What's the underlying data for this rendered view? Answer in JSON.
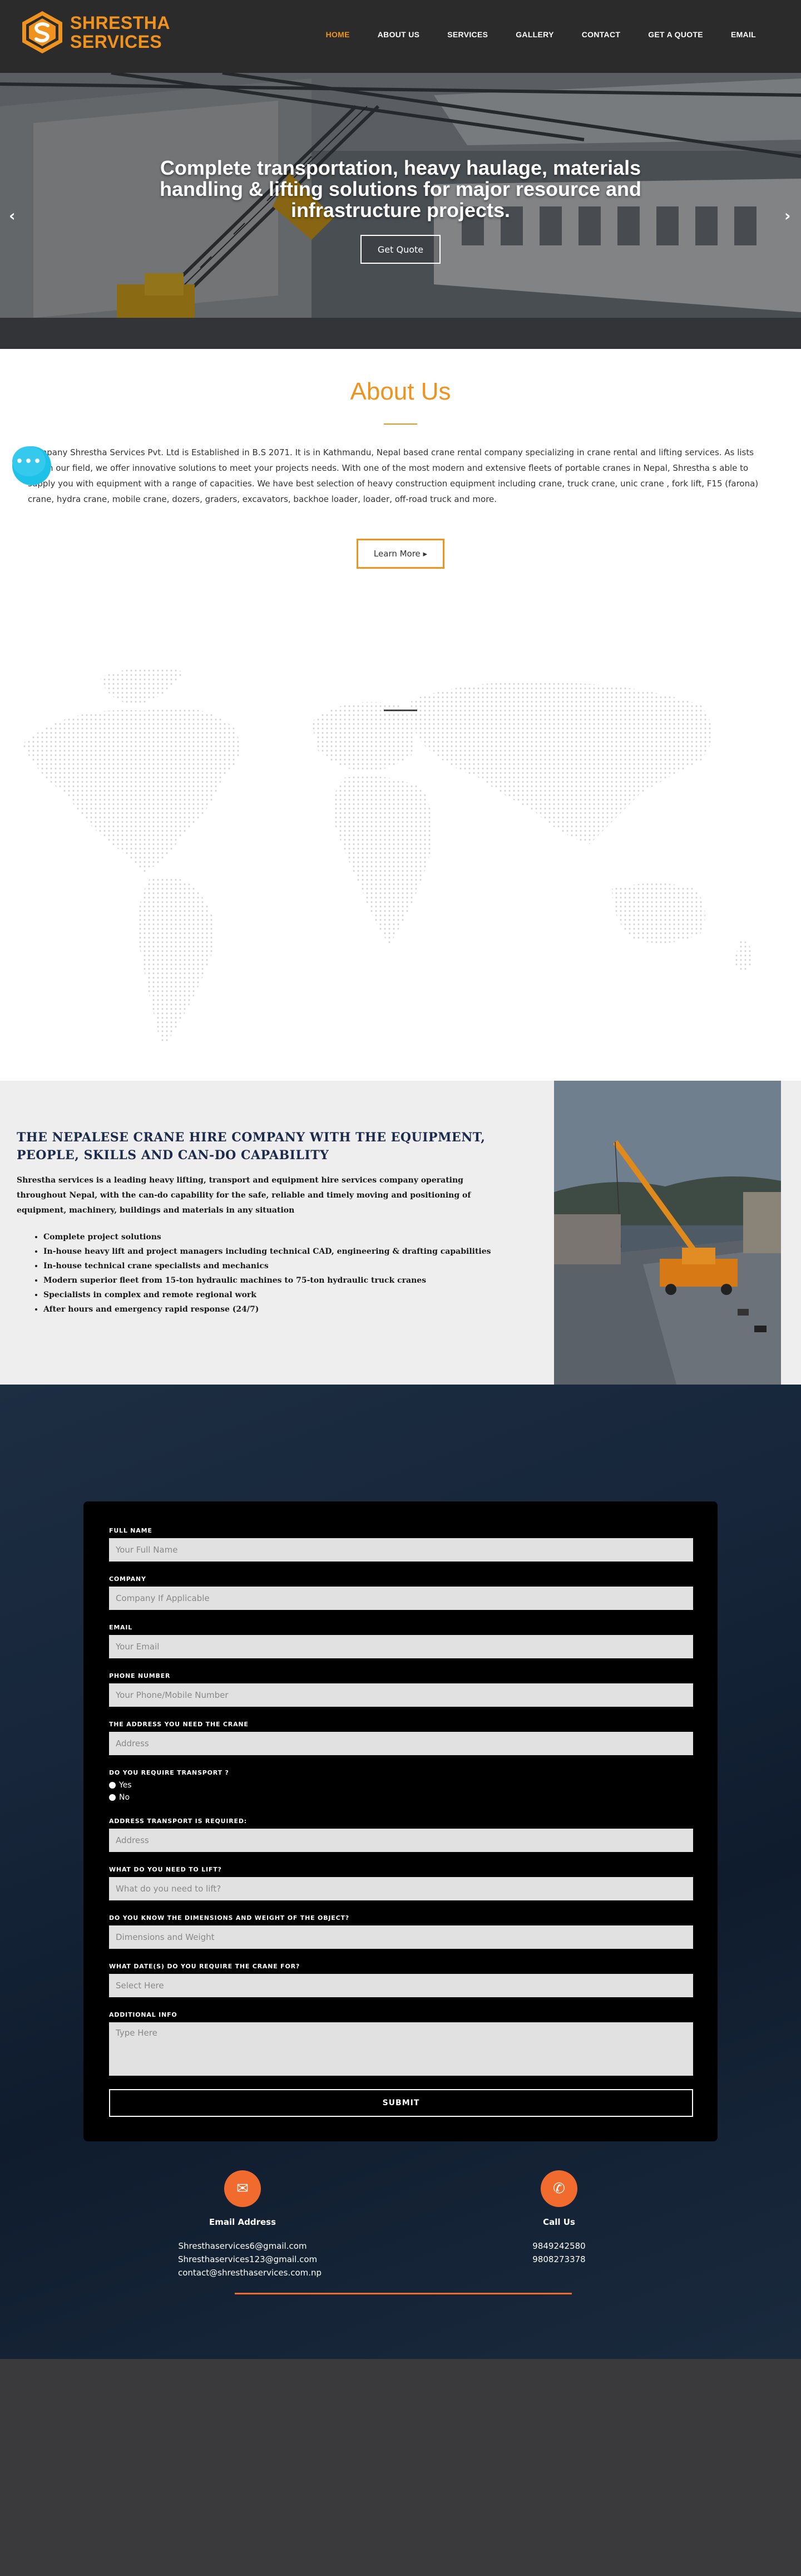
{
  "brand": {
    "line1": "SHRESTHA",
    "line2": "SERVICES",
    "accent": "#f0931e"
  },
  "nav": [
    {
      "label": "HOME",
      "active": true
    },
    {
      "label": "ABOUT US"
    },
    {
      "label": "SERVICES"
    },
    {
      "label": "GALLERY"
    },
    {
      "label": "CONTACT"
    },
    {
      "label": "GET A QUOTE"
    },
    {
      "label": "EMAIL"
    }
  ],
  "hero": {
    "title": "Complete transportation, heavy haulage, materials handling & lifting solutions for major resource and infrastructure projects.",
    "button": "Get Quote",
    "prev_icon": "chevron-left-icon",
    "next_icon": "chevron-right-icon",
    "prev": "‹",
    "next": "›"
  },
  "about": {
    "title": "About Us",
    "text": "Company Shrestha Services Pvt. Ltd is Established in B.S 2071. It is in Kathmandu, Nepal based crane rental company specializing in crane rental and lifting services. As lists within our field, we offer innovative solutions to meet your projects needs. With one of the most modern and extensive fleets of portable cranes in Nepal, Shrestha s able to supply you with equipment with a range of capacities. We have best selection of heavy construction equipment including crane, truck crane, unic crane , fork lift, F15 (farona) crane, hydra crane, mobile crane, dozers, graders, excavators, backhoe loader, loader, off-road truck and more.",
    "button": "Learn More ▸",
    "chat_icon": "chat-icon",
    "chat_glyph": "•••"
  },
  "crane": {
    "title": "THE NEPALESE CRANE HIRE COMPANY WITH THE EQUIPMENT, PEOPLE, SKILLS AND CAN-DO CAPABILITY",
    "desc": "Shrestha services is a leading heavy lifting, transport and equipment hire services company operating throughout Nepal, with the can-do capability for the safe, reliable and timely moving and positioning of equipment, machinery, buildings and materials in any situation",
    "items": [
      "Complete project solutions",
      "In-house heavy lift and project managers including technical CAD, engineering & drafting capabilities",
      "In-house technical crane specialists and mechanics",
      "Modern superior fleet from 15-ton hydraulic machines to 75-ton hydraulic truck cranes",
      "Specialists in complex and remote regional work",
      "After hours and emergency rapid response (24/7)"
    ]
  },
  "form": {
    "full_name_label": "FULL NAME",
    "full_name_ph": "Your Full Name",
    "company_label": "COMPANY",
    "company_ph": "Company If Applicable",
    "email_label": "EMAIL",
    "email_ph": "Your Email",
    "phone_label": "PHONE NUMBER",
    "phone_ph": "Your Phone/Mobile Number",
    "address_label": "THE ADDRESS YOU NEED THE CRANE",
    "address_ph": "Address",
    "transport_label": "DO YOU REQUIRE TRANSPORT ?",
    "yes": "Yes",
    "no": "No",
    "transport_addr_label": "ADDRESS TRANSPORT IS REQUIRED:",
    "transport_addr_ph": "Address",
    "lift_label": "WHAT DO YOU NEED TO LIFT?",
    "lift_ph": "What do you need to lift?",
    "dims_label": "DO YOU KNOW THE DIMENSIONS AND WEIGHT OF THE OBJECT?",
    "dims_ph": "Dimensions and Weight",
    "date_label": "WHAT DATE(S) DO YOU REQUIRE THE CRANE FOR?",
    "date_ph": "Select Here",
    "info_label": "ADDITIONAL INFO",
    "info_ph": "Type Here",
    "submit": "SUBMIT"
  },
  "contact": {
    "email_title": "Email Address",
    "email_icon": "envelope-icon",
    "email_glyph": "✉",
    "emails": [
      "Shresthaservices6@gmail.com",
      "Shresthaservices123@gmail.com",
      "contact@shresthaservices.com.np"
    ],
    "call_title": "Call Us",
    "call_icon": "phone-icon",
    "call_glyph": "✆",
    "phones": [
      "9849242580",
      "9808273378"
    ]
  }
}
